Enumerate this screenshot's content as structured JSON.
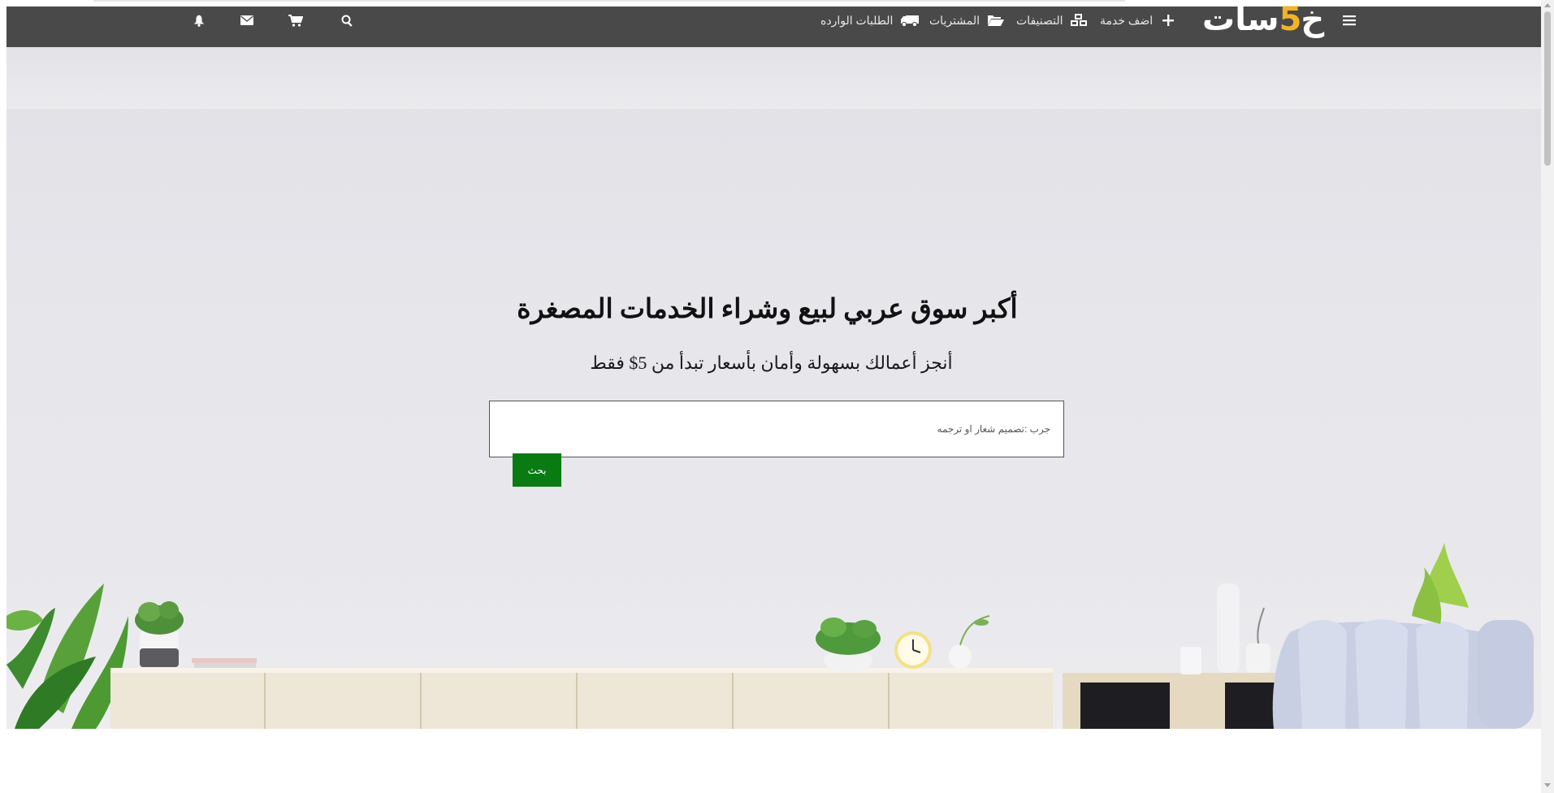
{
  "header": {
    "logo_main": "خمسات",
    "logo_text_a": "خ",
    "logo_text_b": "5",
    "logo_text_c": "سات",
    "menu_icon": "hamburger-icon",
    "nav": [
      {
        "label": "اضف خدمة",
        "icon": "plus-icon"
      },
      {
        "label": "التصنيفات",
        "icon": "cubes-icon"
      },
      {
        "label": "المشتريات",
        "icon": "folder-open-icon"
      },
      {
        "label": "الطلبات الوارده",
        "icon": "truck-icon"
      }
    ],
    "actions": [
      {
        "icon": "search-icon"
      },
      {
        "icon": "cart-icon"
      },
      {
        "icon": "envelope-icon"
      },
      {
        "icon": "bell-icon"
      }
    ]
  },
  "hero": {
    "title": "أكبر سوق عربي لبيع وشراء الخدمات المصغرة",
    "subtitle": "أنجز أعمالك بسهولة وأمان بأسعار تبدأ من 5$ فقط",
    "search_placeholder": "جرب :تصميم شعار او ترجمه",
    "search_value": "",
    "search_button": "بحث"
  },
  "colors": {
    "navbar": "#4a4949",
    "accent": "#f0b429",
    "button": "#0a7a12"
  }
}
